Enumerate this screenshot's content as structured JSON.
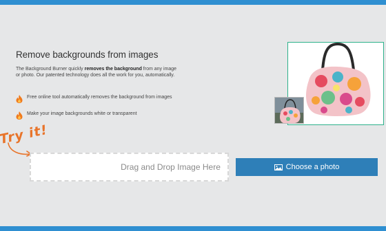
{
  "hero": {
    "title": "Remove backgrounds from images",
    "intro_part1": "The Background Burner quickly ",
    "intro_bold": "removes the background",
    "intro_part2": " from any image or photo. Our patented technology does all the work for you, automatically."
  },
  "features": [
    {
      "icon": "flame-icon",
      "text": "Free online tool automatically removes the background from images"
    },
    {
      "icon": "flame-icon",
      "text": "Make your image backgrounds white or transparent"
    }
  ],
  "tryit": "Try it!",
  "upload": {
    "dropzone_label": "Drag and Drop Image Here",
    "choose_button": "Choose a photo",
    "choose_icon": "image-icon"
  },
  "colors": {
    "accent": "#2f8fd1",
    "button": "#2e7fb8",
    "handwriting": "#e8742a",
    "photo_border": "#2bb18a"
  }
}
